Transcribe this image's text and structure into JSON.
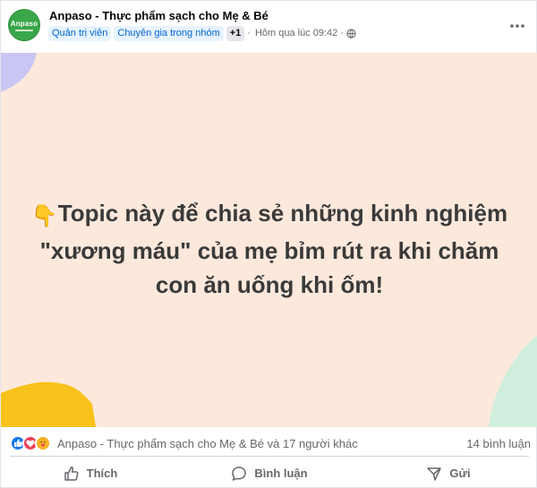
{
  "post": {
    "group_name": "Anpaso - Thực phẩm sạch cho Mẹ & Bé",
    "avatar_text": "Anpaso",
    "badges": [
      "Quản trị viên",
      "Chuyên gia trong nhóm",
      "+1"
    ],
    "time": "Hôm qua lúc 09:42",
    "separator": "·",
    "text_line1": "Topic này để chia sẻ những kinh nghiệm",
    "text_line2": "\"xương máu\" của mẹ bỉm rút ra khi chăm",
    "text_line3": "con ăn uống khi ốm!",
    "emoji": "👇",
    "background_color": "#fde9dc"
  },
  "reactions": {
    "icons": [
      "like-icon",
      "love-icon",
      "care-icon"
    ],
    "summary": "Anpaso - Thực phẩm sạch cho Mẹ & Bé và 17 người khác",
    "comments": "14 bình luận"
  },
  "actions": {
    "like": "Thích",
    "comment": "Bình luận",
    "share": "Gửi"
  }
}
